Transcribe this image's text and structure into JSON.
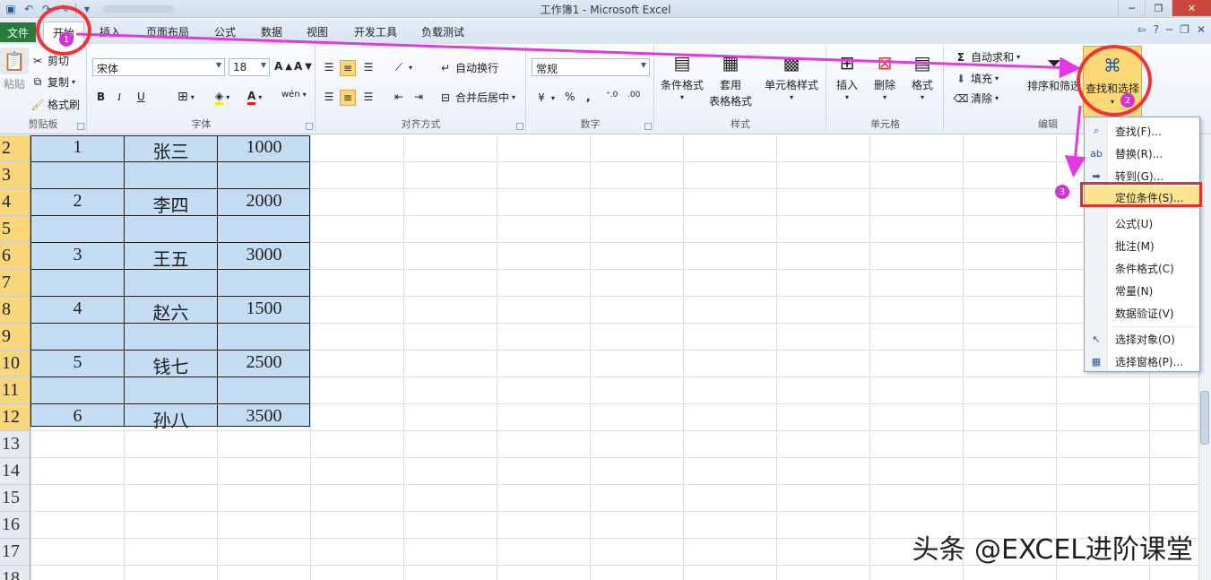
{
  "window": {
    "title": "工作簿1 - Microsoft Excel"
  },
  "tabs": {
    "file": "文件",
    "items": [
      "开始",
      "插入",
      "页面布局",
      "公式",
      "数据",
      "视图",
      "开发工具",
      "负载测试"
    ]
  },
  "ribbon": {
    "clipboard": {
      "label": "剪贴板",
      "paste": "粘贴",
      "cut": "剪切",
      "copy": "复制",
      "format_painter": "格式刷"
    },
    "font": {
      "label": "字体",
      "name": "宋体",
      "size": "18",
      "bold": "B",
      "italic": "I",
      "underline": "U"
    },
    "alignment": {
      "label": "对齐方式",
      "wrap": "自动换行",
      "merge": "合并后居中"
    },
    "number": {
      "label": "数字",
      "format": "常规",
      "percent": "%"
    },
    "styles": {
      "label": "样式",
      "conditional": "条件格式",
      "table_format_1": "套用",
      "table_format_2": "表格格式",
      "cell_styles": "单元格样式"
    },
    "cells": {
      "label": "单元格",
      "insert": "插入",
      "delete": "删除",
      "format": "格式"
    },
    "editing": {
      "label": "编辑",
      "autosum": "自动求和",
      "fill": "填充",
      "clear": "清除",
      "sort_filter": "排序和筛选",
      "find_select": "查找和选择"
    }
  },
  "sheet": {
    "rows": [
      {
        "num": "2",
        "a": "1",
        "b": "张三",
        "c": "1000"
      },
      {
        "num": "3",
        "a": "",
        "b": "",
        "c": ""
      },
      {
        "num": "4",
        "a": "2",
        "b": "李四",
        "c": "2000"
      },
      {
        "num": "5",
        "a": "",
        "b": "",
        "c": ""
      },
      {
        "num": "6",
        "a": "3",
        "b": "王五",
        "c": "3000"
      },
      {
        "num": "7",
        "a": "",
        "b": "",
        "c": ""
      },
      {
        "num": "8",
        "a": "4",
        "b": "赵六",
        "c": "1500"
      },
      {
        "num": "9",
        "a": "",
        "b": "",
        "c": ""
      },
      {
        "num": "10",
        "a": "5",
        "b": "钱七",
        "c": "2500"
      },
      {
        "num": "11",
        "a": "",
        "b": "",
        "c": ""
      },
      {
        "num": "12",
        "a": "6",
        "b": "孙八",
        "c": "3500"
      },
      {
        "num": "13",
        "a": "",
        "b": "",
        "c": ""
      },
      {
        "num": "14",
        "a": "",
        "b": "",
        "c": ""
      },
      {
        "num": "15",
        "a": "",
        "b": "",
        "c": ""
      },
      {
        "num": "16",
        "a": "",
        "b": "",
        "c": ""
      },
      {
        "num": "17",
        "a": "",
        "b": "",
        "c": ""
      },
      {
        "num": "18",
        "a": "",
        "b": "",
        "c": ""
      }
    ]
  },
  "find_menu": {
    "items": [
      {
        "label": "查找(F)...",
        "icon": "binoculars-icon"
      },
      {
        "label": "替换(R)...",
        "icon": "replace-icon"
      },
      {
        "label": "转到(G)...",
        "icon": "arrow-right-icon"
      },
      {
        "label": "定位条件(S)...",
        "icon": ""
      },
      {
        "label": "公式(U)",
        "icon": ""
      },
      {
        "label": "批注(M)",
        "icon": ""
      },
      {
        "label": "条件格式(C)",
        "icon": ""
      },
      {
        "label": "常量(N)",
        "icon": ""
      },
      {
        "label": "数据验证(V)",
        "icon": ""
      },
      {
        "label": "选择对象(O)",
        "icon": "cursor-icon"
      },
      {
        "label": "选择窗格(P)...",
        "icon": "selection-pane-icon"
      }
    ]
  },
  "annotations": {
    "step1": "1",
    "step2": "2",
    "step3": "3",
    "colors": {
      "circle": "#ee3535",
      "arrow": "#e23ae0",
      "badge": "#d630d8"
    }
  },
  "watermark": "头条 @EXCEL进阶课堂"
}
